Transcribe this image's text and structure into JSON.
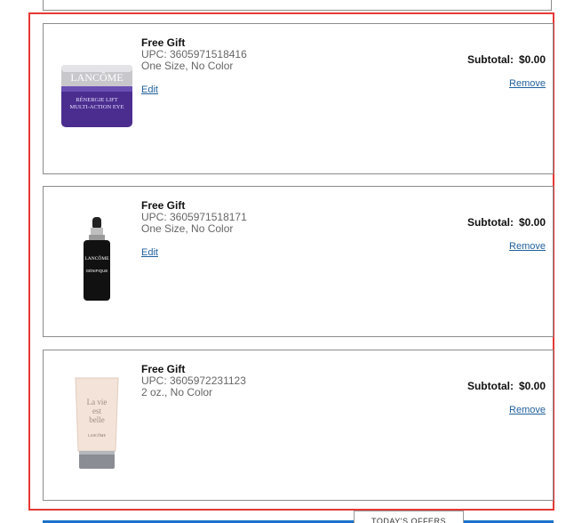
{
  "items": [
    {
      "title": "Free Gift",
      "upc": "UPC: 3605971518416",
      "details": "One Size, No Color",
      "edit_label": "Edit",
      "subtotal_label": "Subtotal:",
      "subtotal_value": "$0.00",
      "remove_label": "Remove",
      "image_icon": "lancome-renergie-eye-cream-jar",
      "image_text": [
        "LANCÔME",
        "RÉNERGIE LIFT",
        "MULTI-ACTION EYE"
      ]
    },
    {
      "title": "Free Gift",
      "upc": "UPC: 3605971518171",
      "details": "One Size, No Color",
      "edit_label": "Edit",
      "subtotal_label": "Subtotal:",
      "subtotal_value": "$0.00",
      "remove_label": "Remove",
      "image_icon": "lancome-genifique-serum-bottle",
      "image_text": [
        "LANCÔME",
        "GÉNIFIQUE"
      ]
    },
    {
      "title": "Free Gift",
      "upc": "UPC: 3605972231123",
      "details": "2 oz., No Color",
      "edit_label": "Edit",
      "subtotal_label": "Subtotal:",
      "subtotal_value": "$0.00",
      "remove_label": "Remove",
      "image_icon": "lancome-la-vie-est-belle-lotion-tube",
      "image_text": [
        "La vie",
        "est",
        "belle",
        "LANCÔME"
      ]
    }
  ],
  "offers_tab_label": "TODAY'S OFFERS",
  "colors": {
    "highlight": "#e53935",
    "link": "#1f5f9c",
    "accent_bar": "#1a73c8"
  }
}
